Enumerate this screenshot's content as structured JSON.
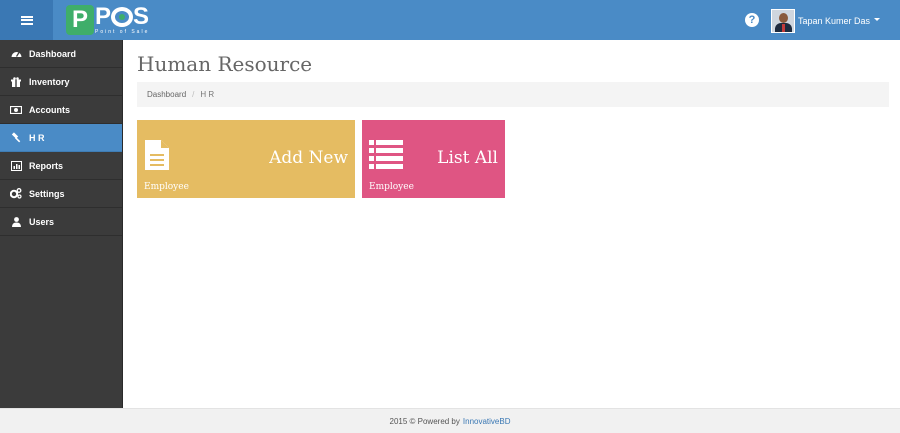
{
  "header": {
    "logo": {
      "letter": "P",
      "word_1": "P",
      "word_2": "S",
      "tagline": "Point of Sale"
    },
    "menu_icon": "hamburger-icon",
    "help_icon": "question-circle-icon",
    "user": {
      "name": "Tapan Kumer Das"
    },
    "colors": {
      "bar": "#4a8bc6",
      "toggle": "#3a78b4",
      "logo_green": "#3fae6a"
    }
  },
  "sidebar": {
    "items": [
      {
        "label": "Dashboard",
        "icon": "dashboard-icon",
        "active": false
      },
      {
        "label": "Inventory",
        "icon": "gift-icon",
        "active": false
      },
      {
        "label": "Accounts",
        "icon": "money-icon",
        "active": false
      },
      {
        "label": "H R",
        "icon": "gavel-icon",
        "active": true
      },
      {
        "label": "Reports",
        "icon": "bar-chart-icon",
        "active": false
      },
      {
        "label": "Settings",
        "icon": "cogs-icon",
        "active": false
      },
      {
        "label": "Users",
        "icon": "user-icon",
        "active": false
      }
    ],
    "colors": {
      "background": "#3b3b3b",
      "active": "#4a8bc6"
    }
  },
  "main": {
    "title": "Human Resource",
    "breadcrumb": [
      {
        "label": "Dashboard"
      },
      {
        "label": "H R"
      }
    ],
    "tiles": [
      {
        "title": "Add New",
        "subtitle": "Employee",
        "icon": "file-text-icon",
        "color": "#e5bc62"
      },
      {
        "title": "List All",
        "subtitle": "Employee",
        "icon": "list-icon",
        "color": "#df5583"
      }
    ]
  },
  "footer": {
    "text": "2015 © Powered by",
    "link": "InnovativeBD"
  }
}
